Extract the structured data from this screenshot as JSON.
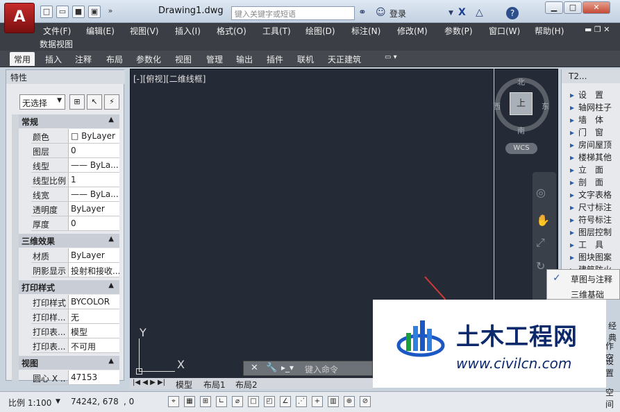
{
  "titlebar": {
    "app_letter": "A",
    "doc_title": "Drawing1.dwg",
    "search_placeholder": "键入关键字或短语",
    "login": "登录",
    "help": "?"
  },
  "menus": [
    "文件(F)",
    "编辑(E)",
    "视图(V)",
    "插入(I)",
    "格式(O)",
    "工具(T)",
    "绘图(D)",
    "标注(N)",
    "修改(M)",
    "参数(P)",
    "窗口(W)",
    "帮助(H)"
  ],
  "menu_row2": "数据视图",
  "ribbon_tabs": [
    "常用",
    "插入",
    "注释",
    "布局",
    "参数化",
    "视图",
    "管理",
    "输出",
    "插件",
    "联机",
    "天正建筑"
  ],
  "properties": {
    "title": "特性",
    "selection": "无选择",
    "sections": {
      "general": "常规",
      "effects3d": "三维效果",
      "plot": "打印样式",
      "view": "视图"
    },
    "general_rows": [
      {
        "k": "颜色",
        "v": "□ ByLayer"
      },
      {
        "k": "图层",
        "v": "0"
      },
      {
        "k": "线型",
        "v": "—— ByLa..."
      },
      {
        "k": "线型比例",
        "v": "1"
      },
      {
        "k": "线宽",
        "v": "—— ByLa..."
      },
      {
        "k": "透明度",
        "v": "ByLayer"
      },
      {
        "k": "厚度",
        "v": "0"
      }
    ],
    "effects_rows": [
      {
        "k": "材质",
        "v": "ByLayer"
      },
      {
        "k": "阴影显示",
        "v": "投射和接收..."
      }
    ],
    "plot_rows": [
      {
        "k": "打印样式",
        "v": "BYCOLOR"
      },
      {
        "k": "打印样...",
        "v": "无"
      },
      {
        "k": "打印表...",
        "v": "模型"
      },
      {
        "k": "打印表...",
        "v": "不可用"
      }
    ],
    "view_rows": [
      {
        "k": "圆心 X ...",
        "v": "47153"
      }
    ]
  },
  "viewport": {
    "label": "[-][俯视][二维线框]",
    "north": "北",
    "south": "南",
    "west": "西",
    "east": "东",
    "cube_face": "上",
    "wcs": "WCS",
    "ucs_x": "X",
    "ucs_y": "Y"
  },
  "command": {
    "placeholder": "键入命令"
  },
  "layout_tabs": [
    "模型",
    "布局1",
    "布局2"
  ],
  "status": {
    "scale": "比例 1:100",
    "coords": "74242, 678",
    "z": ", 0"
  },
  "t2": {
    "title": "T2...",
    "items": [
      "设　置",
      "轴网柱子",
      "墙　体",
      "门　窗",
      "房间屋顶",
      "楼梯其他",
      "立　面",
      "剖　面",
      "文字表格",
      "尺寸标注",
      "符号标注",
      "图层控制",
      "工　具",
      "图块图案",
      "建筑防火"
    ]
  },
  "popup": {
    "items": [
      "草图与注释",
      "三维基础"
    ]
  },
  "edge_texts": [
    "经典",
    "作空",
    "设置",
    "空间"
  ],
  "watermark": {
    "title": "土木工程网",
    "url": "www.civilcn.com"
  },
  "colors": {
    "canvas": "#252b36",
    "accent": "#2a5fb0",
    "app_red": "#c62b2b"
  }
}
